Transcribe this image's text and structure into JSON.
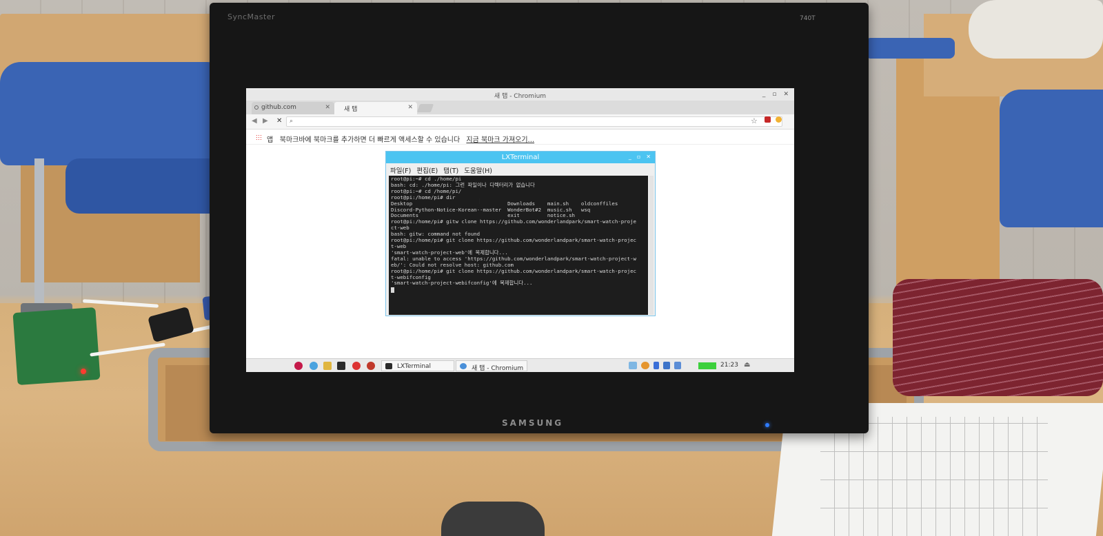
{
  "monitor": {
    "brand_label": "SyncMaster",
    "model_label": "740T",
    "maker_logo": "SAMSUNG"
  },
  "chromium": {
    "window_title": "새 탭 - Chromium",
    "window_controls": [
      "_",
      "▫",
      "✕"
    ],
    "tabs": [
      {
        "label": "github.com",
        "active": false
      },
      {
        "label": "새 탭",
        "active": true
      }
    ],
    "tab_close": "✕",
    "nav": {
      "back": "◀",
      "forward": "▶",
      "stop": "✕"
    },
    "omnibox": {
      "value": "",
      "icon": "search-icon"
    },
    "bookmark_bar": {
      "apps_label": "앱",
      "message": "북마크바에 북마크를 추가하면 더 빠르게 액세스할 수 있습니다",
      "import_link": "지금 북마크 가져오기..."
    }
  },
  "terminal": {
    "title": "LXTerminal",
    "window_controls": [
      "_",
      "▫",
      "✕"
    ],
    "menu": [
      "파일(F)",
      "편집(E)",
      "탭(T)",
      "도움말(H)"
    ],
    "lines": [
      "root@pi:~# cd ./home/pi",
      "bash: cd: ./home/pi: 그런 파일이나 디렉터리가 없습니다",
      "root@pi:~# cd /home/pi/",
      "root@pi:/home/pi# dir",
      "Desktop                               Downloads    main.sh    oldconffiles",
      "Discord-Python-Notice-Korean--master  WonderBot#2  music.sh   wsq",
      "Documents                             exit         notice.sh",
      "root@pi:/home/pi# gitw clone https://github.com/wonderlandpark/smart-watch-proje",
      "ct-web",
      "bash: gitw: command not found",
      "root@pi:/home/pi# git clone https://github.com/wonderlandpark/smart-watch-projec",
      "t-web",
      "'smart-watch-project-web'에 복제합니다...",
      "fatal: unable to access 'https://github.com/wonderlandpark/smart-watch-project-w",
      "eb/': Could not resolve host: github.com",
      "root@pi:/home/pi# git clone https://github.com/wonderlandpark/smart-watch-projec",
      "t-webifconfig",
      "'smart-watch-project-webifconfig'에 복제합니다..."
    ]
  },
  "taskbar": {
    "tasks": [
      {
        "label": "LXTerminal",
        "icon": "terminal-icon"
      },
      {
        "label": "새 탭 - Chromium",
        "icon": "chromium-icon"
      }
    ],
    "cpu_label": "",
    "clock": "21:23"
  },
  "colors": {
    "terminal_titlebar": "#4cc4f1",
    "terminal_bg": "#1d1d1d",
    "terminal_fg": "#d8d8d8",
    "bezel": "#161616",
    "power_led": "#2f7cff",
    "pi_led": "#ff3b2f"
  }
}
